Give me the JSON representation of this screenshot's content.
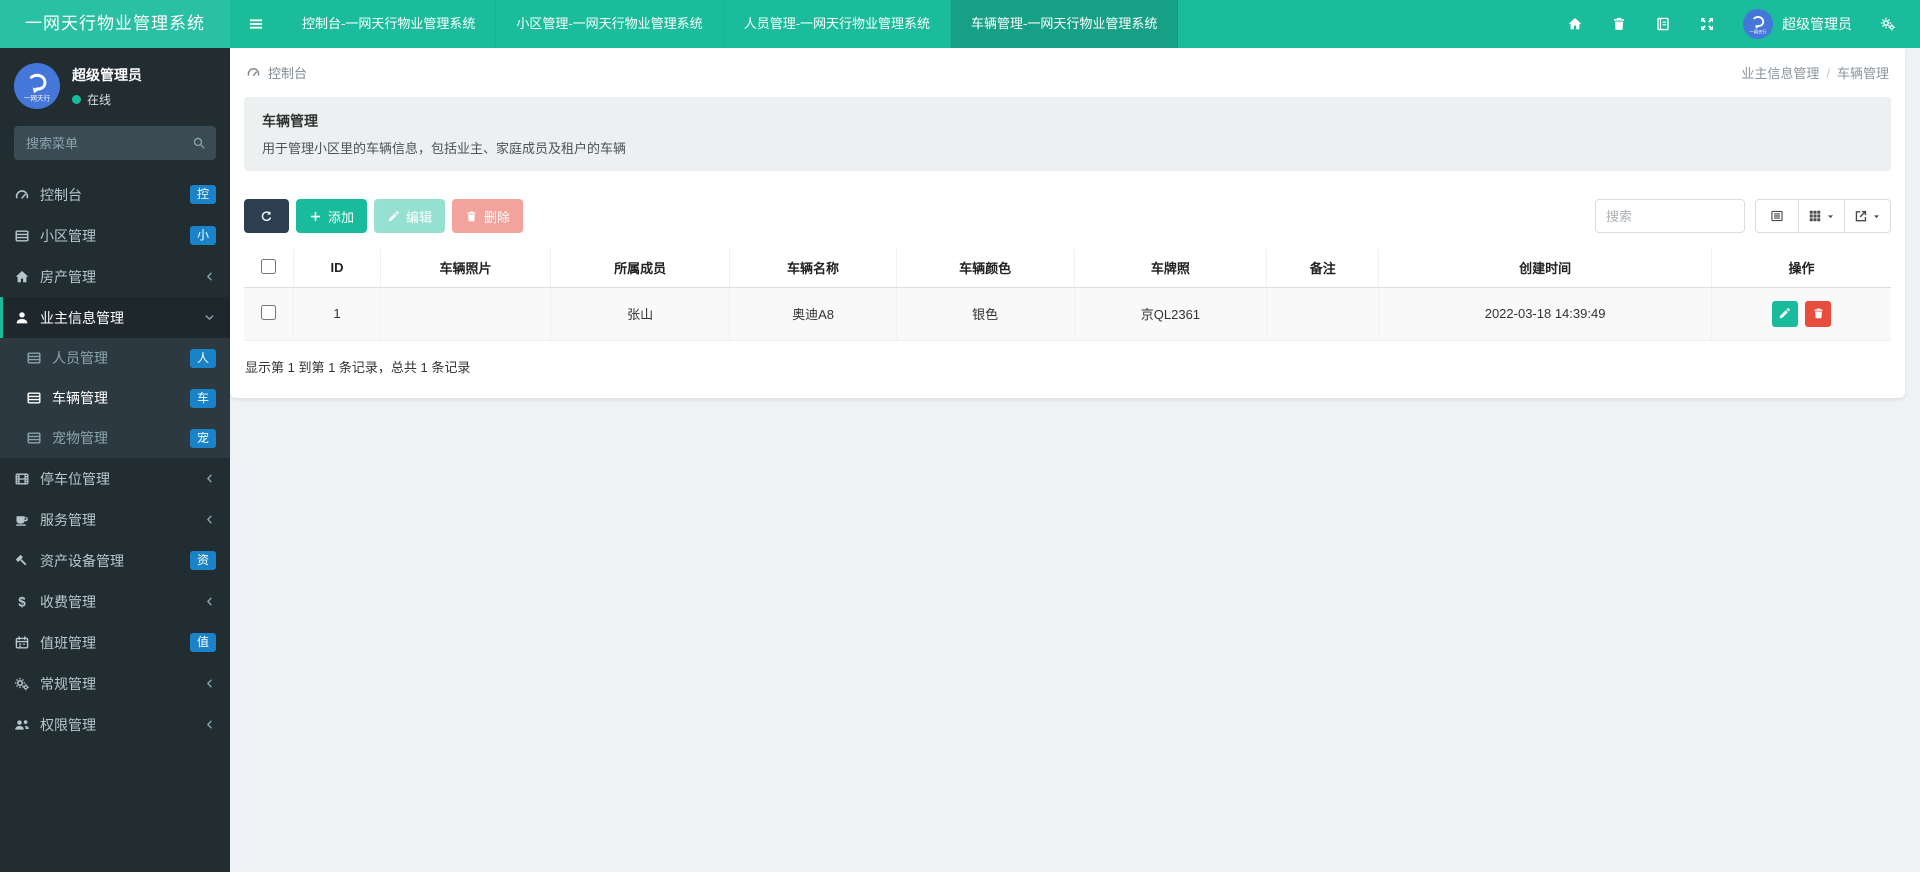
{
  "navbar": {
    "brand": "一网天行物业管理系统",
    "tabs": [
      {
        "label": "控制台-一网天行物业管理系统"
      },
      {
        "label": "小区管理-一网天行物业管理系统"
      },
      {
        "label": "人员管理-一网天行物业管理系统"
      },
      {
        "label": "车辆管理-一网天行物业管理系统"
      }
    ],
    "user_name": "超级管理员"
  },
  "sidebar": {
    "user": {
      "name": "超级管理员",
      "status": "在线"
    },
    "search_placeholder": "搜索菜单",
    "items": [
      {
        "label": "控制台",
        "badge": "控"
      },
      {
        "label": "小区管理",
        "badge": "小"
      },
      {
        "label": "房产管理"
      },
      {
        "label": "业主信息管理",
        "children": [
          {
            "label": "人员管理",
            "badge": "人"
          },
          {
            "label": "车辆管理",
            "badge": "车"
          },
          {
            "label": "宠物管理",
            "badge": "宠"
          }
        ]
      },
      {
        "label": "停车位管理"
      },
      {
        "label": "服务管理"
      },
      {
        "label": "资产设备管理",
        "badge": "资"
      },
      {
        "label": "收费管理"
      },
      {
        "label": "值班管理",
        "badge": "值"
      },
      {
        "label": "常规管理"
      },
      {
        "label": "权限管理"
      }
    ]
  },
  "breadcrumb": {
    "left": "控制台",
    "right_parent": "业主信息管理",
    "sep": "/",
    "right_current": "车辆管理"
  },
  "panel": {
    "title": "车辆管理",
    "description": "用于管理小区里的车辆信息，包括业主、家庭成员及租户的车辆"
  },
  "toolbar": {
    "add_label": "添加",
    "edit_label": "编辑",
    "delete_label": "删除",
    "search_placeholder": "搜索"
  },
  "table": {
    "columns": [
      "ID",
      "车辆照片",
      "所属成员",
      "车辆名称",
      "车辆颜色",
      "车牌照",
      "备注",
      "创建时间",
      "操作"
    ],
    "rows": [
      {
        "id": "1",
        "photo": "",
        "member": "张山",
        "name": "奥迪A8",
        "color": "银色",
        "plate": "京QL2361",
        "remark": "",
        "created": "2022-03-18 14:39:49"
      }
    ]
  },
  "footer": {
    "summary": "显示第 1 到第 1 条记录，总共 1 条记录"
  },
  "colors": {
    "accent": "#18bc9c",
    "navbar": "#1abc9c",
    "danger": "#e74c3c",
    "badge": "#1a82c8",
    "sidebar": "#222d32",
    "dark_button": "#2c3e50"
  }
}
